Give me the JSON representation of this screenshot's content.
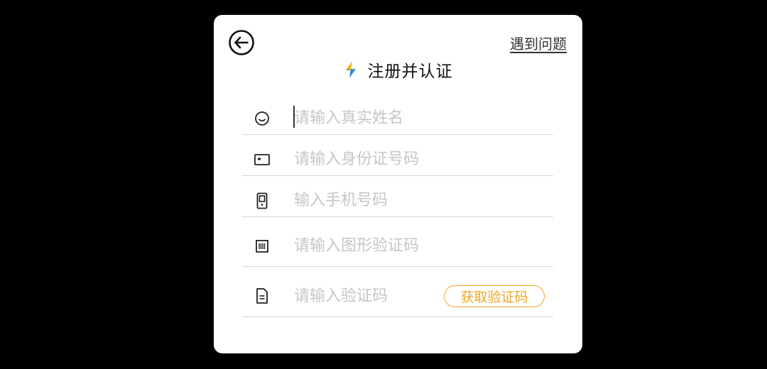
{
  "header": {
    "help_label": "遇到问题",
    "title": "注册并认证",
    "back_icon": "arrow-left-circle-icon",
    "logo_icon": "lightning-icon"
  },
  "form": {
    "name": {
      "placeholder": "请输入真实姓名",
      "icon": "smile-icon"
    },
    "id_card": {
      "placeholder": "请输入身份证号码",
      "icon": "id-card-icon"
    },
    "phone": {
      "placeholder": "输入手机号码",
      "icon": "phone-icon"
    },
    "captcha": {
      "placeholder": "请输入图形验证码",
      "icon": "barcode-icon"
    },
    "sms_code": {
      "placeholder": "请输入验证码",
      "icon": "document-icon",
      "get_code_label": "获取验证码"
    }
  },
  "colors": {
    "accent": "#f0a524",
    "background": "#000000",
    "card": "#ffffff",
    "divider": "#d8d8d8",
    "placeholder": "#c6c6c6"
  }
}
